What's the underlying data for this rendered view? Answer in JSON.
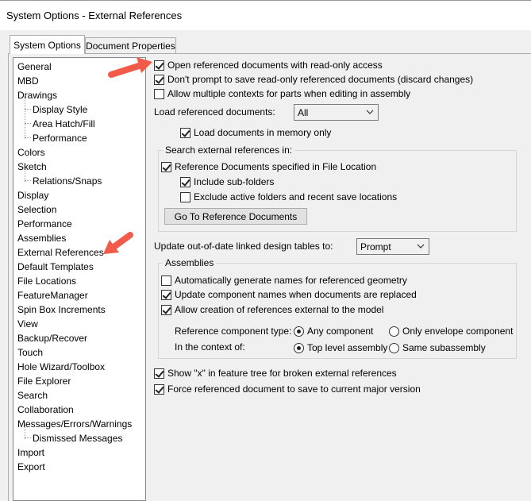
{
  "window": {
    "title": "System Options - External References"
  },
  "tabs": [
    {
      "label": "System Options",
      "active": true
    },
    {
      "label": "Document Properties",
      "active": false
    }
  ],
  "tree": {
    "items": [
      {
        "label": "General",
        "child": false
      },
      {
        "label": "MBD",
        "child": false
      },
      {
        "label": "Drawings",
        "child": false
      },
      {
        "label": "Display Style",
        "child": true
      },
      {
        "label": "Area Hatch/Fill",
        "child": true
      },
      {
        "label": "Performance",
        "child": true
      },
      {
        "label": "Colors",
        "child": false
      },
      {
        "label": "Sketch",
        "child": false
      },
      {
        "label": "Relations/Snaps",
        "child": true
      },
      {
        "label": "Display",
        "child": false
      },
      {
        "label": "Selection",
        "child": false
      },
      {
        "label": "Performance",
        "child": false
      },
      {
        "label": "Assemblies",
        "child": false
      },
      {
        "label": "External References",
        "child": false,
        "selected": true
      },
      {
        "label": "Default Templates",
        "child": false
      },
      {
        "label": "File Locations",
        "child": false
      },
      {
        "label": "FeatureManager",
        "child": false
      },
      {
        "label": "Spin Box Increments",
        "child": false
      },
      {
        "label": "View",
        "child": false
      },
      {
        "label": "Backup/Recover",
        "child": false
      },
      {
        "label": "Touch",
        "child": false
      },
      {
        "label": "Hole Wizard/Toolbox",
        "child": false
      },
      {
        "label": "File Explorer",
        "child": false
      },
      {
        "label": "Search",
        "child": false
      },
      {
        "label": "Collaboration",
        "child": false
      },
      {
        "label": "Messages/Errors/Warnings",
        "child": false
      },
      {
        "label": "Dismissed Messages",
        "child": true
      },
      {
        "label": "Import",
        "child": false
      },
      {
        "label": "Export",
        "child": false
      }
    ]
  },
  "options": {
    "open_readonly": {
      "label": "Open referenced documents with read-only access",
      "checked": true
    },
    "dont_prompt": {
      "label": "Don't prompt to save read-only referenced documents (discard changes)",
      "checked": true
    },
    "multiple_contexts": {
      "label": "Allow multiple contexts for parts when editing in assembly",
      "checked": false
    },
    "load_label": "Load referenced documents:",
    "load_value": "All",
    "load_memory": {
      "label": "Load documents in memory only",
      "checked": true
    },
    "search_group": {
      "title": "Search external references in:",
      "file_location": {
        "label": "Reference Documents specified in File Location",
        "checked": true
      },
      "sub_folders": {
        "label": "Include sub-folders",
        "checked": true
      },
      "exclude_active": {
        "label": "Exclude active folders and recent save locations",
        "checked": false
      },
      "goto_button": "Go To Reference Documents"
    },
    "design_tables_label": "Update out-of-date linked design tables to:",
    "design_tables_value": "Prompt",
    "assemblies_group": {
      "title": "Assemblies",
      "auto_names": {
        "label": "Automatically generate names for referenced geometry",
        "checked": false
      },
      "update_names": {
        "label": "Update component names when documents are replaced",
        "checked": true
      },
      "allow_external": {
        "label": "Allow creation of references external to the model",
        "checked": true
      },
      "ref_type_label": "Reference component type:",
      "ref_type_options": [
        {
          "label": "Any component",
          "checked": true
        },
        {
          "label": "Only envelope component",
          "checked": false
        }
      ],
      "context_label": "In the context of:",
      "context_options": [
        {
          "label": "Top level assembly",
          "checked": true
        },
        {
          "label": "Same subassembly",
          "checked": false
        }
      ]
    },
    "show_x": {
      "label": "Show \"x\" in feature tree for broken external references",
      "checked": true
    },
    "force_save": {
      "label": "Force referenced document to save to current major version",
      "checked": true
    }
  },
  "colors": {
    "annotation_arrow": "#f25a4a"
  }
}
